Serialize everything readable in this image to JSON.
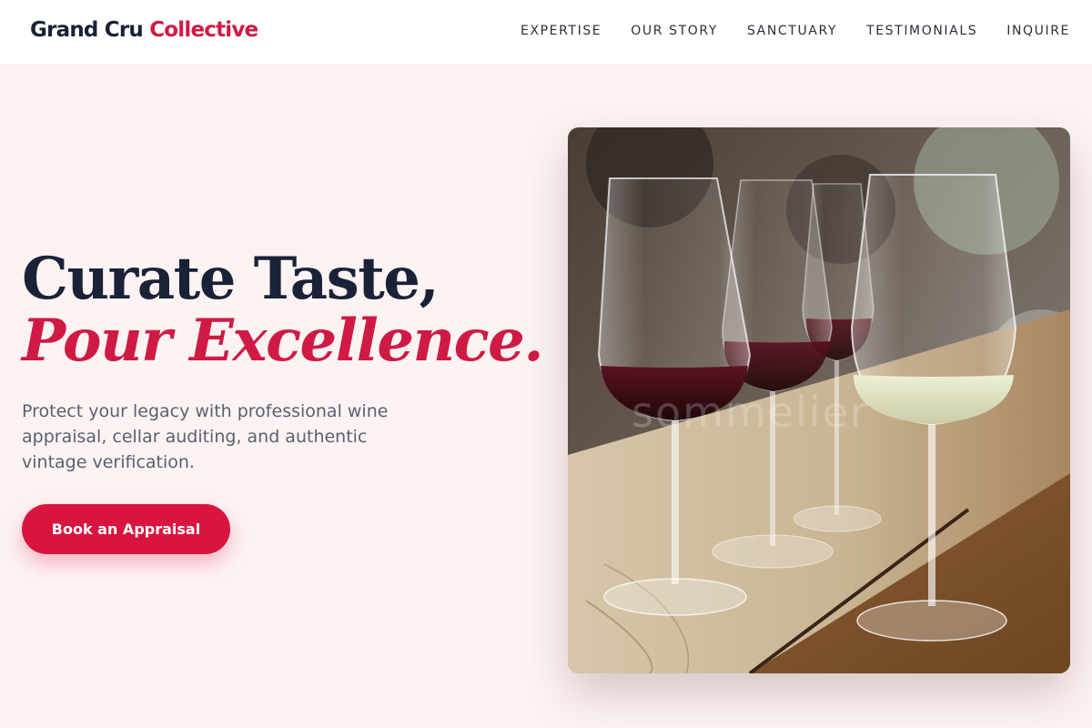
{
  "header": {
    "logo_primary": "Grand Cru",
    "logo_accent": "Collective",
    "nav": [
      "EXPERTISE",
      "OUR STORY",
      "SANCTUARY",
      "TESTIMONIALS",
      "INQUIRE"
    ]
  },
  "hero": {
    "headline_line1": "Curate Taste,",
    "headline_line2": "Pour Excellence.",
    "subtitle": "Protect your legacy with professional wine appraisal, cellar auditing, and authentic vintage verification.",
    "cta_label": "Book an Appraisal"
  },
  "photo": {
    "watermark": "sommelier"
  },
  "colors": {
    "accent": "#cf1a44",
    "button": "#d9153f",
    "navy": "#1a2238",
    "background": "#fdf3f3"
  }
}
